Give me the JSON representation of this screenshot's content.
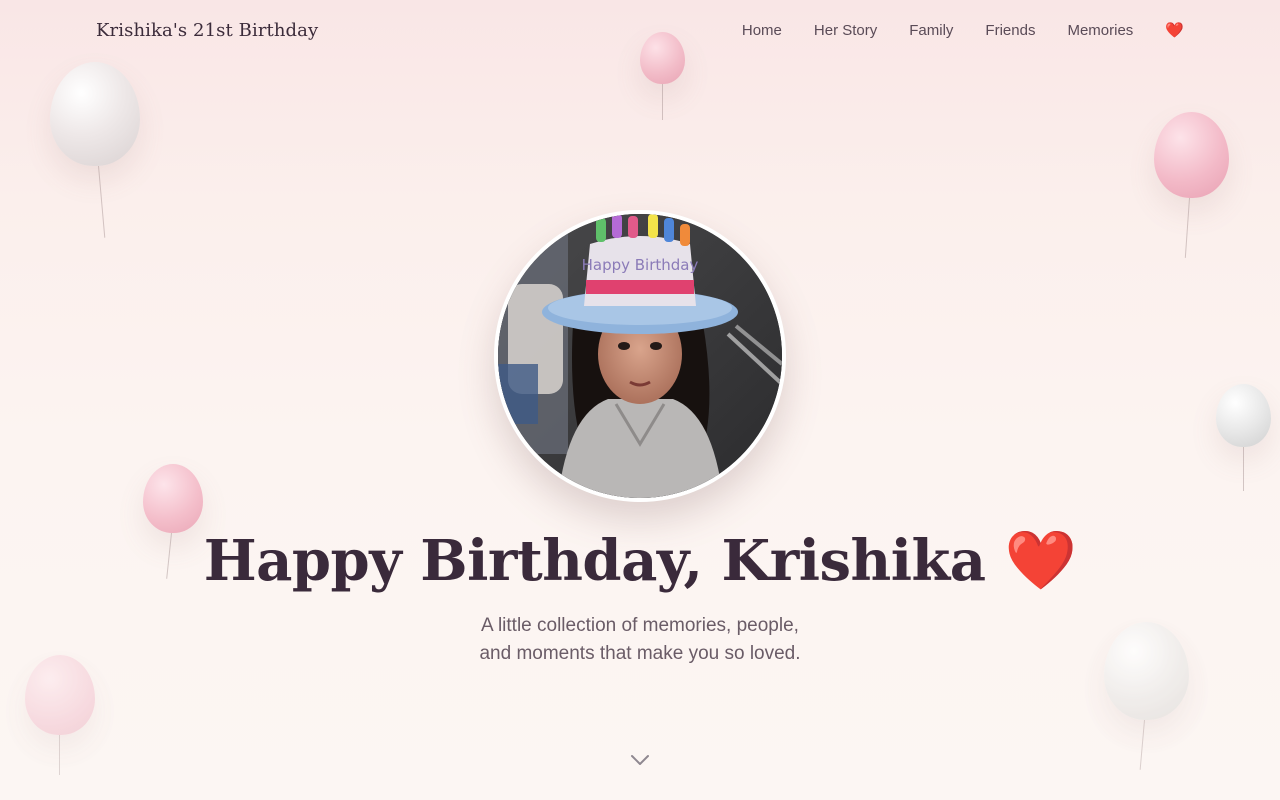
{
  "nav": {
    "brand": "Krishika's 21st Birthday",
    "links": [
      "Home",
      "Her Story",
      "Family",
      "Friends",
      "Memories"
    ],
    "heart": "❤️"
  },
  "hero": {
    "title": "Happy Birthday, Krishika",
    "title_emoji": "❤️",
    "subtitle_line1": "A little collection of memories, people,",
    "subtitle_line2": "and moments that make you so loved.",
    "photo_hat_text": "Happy Birthday"
  },
  "icons": {
    "scroll": "chevron-down-icon"
  },
  "colors": {
    "background_top": "#f9e6e6",
    "background_bottom": "#fcf6f3",
    "title": "#3a2a3b",
    "heart": "#e0282e",
    "balloon_pink": "#f1b7c4",
    "balloon_white": "#ebe5e5"
  }
}
